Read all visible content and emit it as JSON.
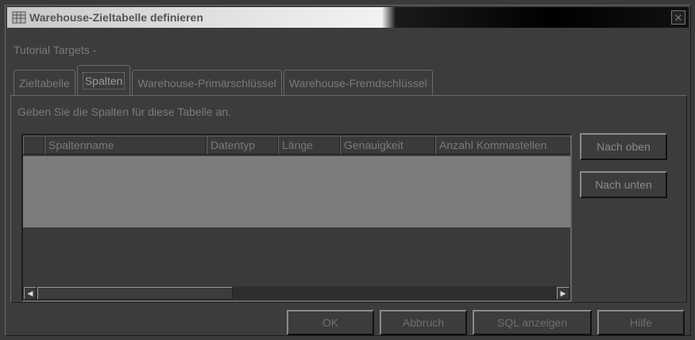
{
  "window": {
    "title": "Warehouse-Zieltabelle definieren",
    "close_glyph": "✕"
  },
  "subtitle": "Tutorial Targets -",
  "tabs": [
    {
      "label": "Zieltabelle",
      "active": false
    },
    {
      "label": "Spalten",
      "active": true
    },
    {
      "label": "Warehouse-Primärschlüssel",
      "active": false
    },
    {
      "label": "Warehouse-Fremdschlüssel",
      "active": false
    }
  ],
  "panel": {
    "instruction": "Geben Sie die Spalten für diese Tabelle an."
  },
  "table": {
    "columns": [
      "",
      "Spaltenname",
      "Datentyp",
      "Länge",
      "Genauigkeit",
      "Anzahl Kommastellen"
    ],
    "rows": []
  },
  "side_buttons": {
    "up_label": "Nach oben",
    "down_label": "Nach unten"
  },
  "buttons": {
    "ok": "OK",
    "cancel": "Abbruch",
    "sql": "SQL anzeigen",
    "help": "Hilfe"
  },
  "icons": {
    "app": "table-icon",
    "scroll_left": "◀",
    "scroll_right": "▶"
  }
}
